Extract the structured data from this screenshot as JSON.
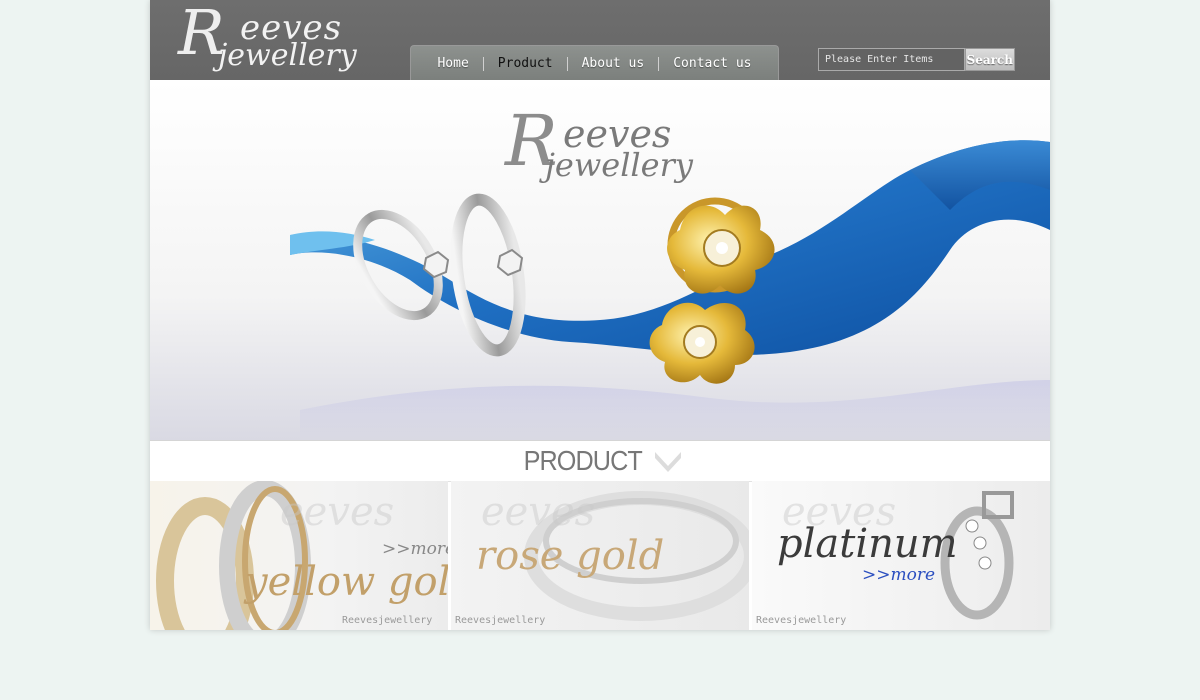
{
  "brand": {
    "logo_line1": "eeves",
    "logo_line2": "jewellery",
    "logo_initial": "R"
  },
  "nav": {
    "items": [
      {
        "label": "Home"
      },
      {
        "label": "Product",
        "active": true
      },
      {
        "label": "About us"
      },
      {
        "label": "Contact us"
      }
    ]
  },
  "search": {
    "placeholder": "Please Enter Items",
    "button_label": "Search"
  },
  "section": {
    "title": "PRODUCT"
  },
  "cards": [
    {
      "name": "yellow gold",
      "more": ">>more",
      "footer": "Reevesjewellery",
      "name_color": "#c2a06a",
      "more_color": "#888888"
    },
    {
      "name": "rose gold",
      "more": "",
      "footer": "Reevesjewellery",
      "name_color": "#c8a878",
      "more_color": "#888888"
    },
    {
      "name": "platinum",
      "more": ">>more",
      "footer": "Reevesjewellery",
      "name_color": "#3b3b3b",
      "more_color": "#2b4fc0"
    }
  ],
  "colors": {
    "header_bg": "#6a6a6a",
    "nav_bg": "#858986",
    "page_bg": "#edf4f2",
    "silk_blue": "#1f6fc2"
  }
}
